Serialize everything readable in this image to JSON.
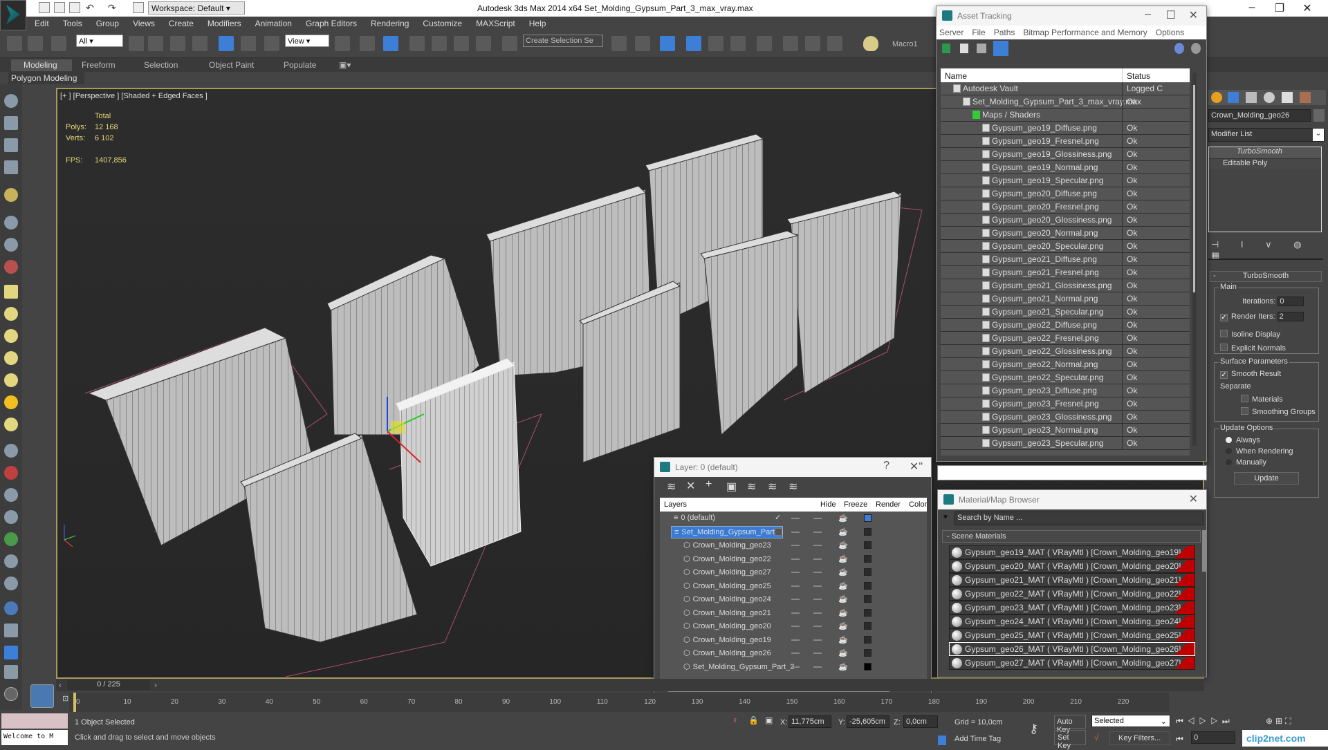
{
  "window": {
    "title": "Autodesk 3ds Max  2014 x64     Set_Molding_Gypsum_Part_3_max_vray.max",
    "workspace": "Workspace: Default"
  },
  "menu": [
    "Edit",
    "Tools",
    "Group",
    "Views",
    "Create",
    "Modifiers",
    "Animation",
    "Graph Editors",
    "Rendering",
    "Customize",
    "MAXScript",
    "Help"
  ],
  "toolbar": {
    "filter": "All",
    "refcoord": "View",
    "selection_set": "Create Selection Se",
    "macro": "Macro1"
  },
  "ribbon": {
    "tabs": [
      "Modeling",
      "Freeform",
      "Selection",
      "Object Paint",
      "Populate"
    ],
    "panel": "Polygon Modeling"
  },
  "viewport": {
    "label": "[+ ] [Perspective ] [Shaded + Edged Faces ]",
    "total_label": "Total",
    "polys_label": "Polys:",
    "polys": "12 168",
    "verts_label": "Verts:",
    "verts": "6 102",
    "fps_label": "FPS:",
    "fps": "1407,856"
  },
  "asset_tracking": {
    "title": "Asset Tracking",
    "menu": [
      "Server",
      "File",
      "Paths",
      "Bitmap Performance and Memory",
      "Options"
    ],
    "col_name": "Name",
    "col_status": "Status",
    "rows": [
      {
        "name": "Autodesk Vault",
        "status": "Logged C",
        "level": 1
      },
      {
        "name": "Set_Molding_Gypsum_Part_3_max_vray.max",
        "status": "Ok",
        "level": 2
      },
      {
        "name": "Maps / Shaders",
        "status": "",
        "level": 3
      },
      {
        "name": "Gypsum_geo19_Diffuse.png",
        "status": "Ok",
        "level": 4
      },
      {
        "name": "Gypsum_geo19_Fresnel.png",
        "status": "Ok",
        "level": 4
      },
      {
        "name": "Gypsum_geo19_Glossiness.png",
        "status": "Ok",
        "level": 4
      },
      {
        "name": "Gypsum_geo19_Normal.png",
        "status": "Ok",
        "level": 4
      },
      {
        "name": "Gypsum_geo19_Specular.png",
        "status": "Ok",
        "level": 4
      },
      {
        "name": "Gypsum_geo20_Diffuse.png",
        "status": "Ok",
        "level": 4
      },
      {
        "name": "Gypsum_geo20_Fresnel.png",
        "status": "Ok",
        "level": 4
      },
      {
        "name": "Gypsum_geo20_Glossiness.png",
        "status": "Ok",
        "level": 4
      },
      {
        "name": "Gypsum_geo20_Normal.png",
        "status": "Ok",
        "level": 4
      },
      {
        "name": "Gypsum_geo20_Specular.png",
        "status": "Ok",
        "level": 4
      },
      {
        "name": "Gypsum_geo21_Diffuse.png",
        "status": "Ok",
        "level": 4
      },
      {
        "name": "Gypsum_geo21_Fresnel.png",
        "status": "Ok",
        "level": 4
      },
      {
        "name": "Gypsum_geo21_Glossiness.png",
        "status": "Ok",
        "level": 4
      },
      {
        "name": "Gypsum_geo21_Normal.png",
        "status": "Ok",
        "level": 4
      },
      {
        "name": "Gypsum_geo21_Specular.png",
        "status": "Ok",
        "level": 4
      },
      {
        "name": "Gypsum_geo22_Diffuse.png",
        "status": "Ok",
        "level": 4
      },
      {
        "name": "Gypsum_geo22_Fresnel.png",
        "status": "Ok",
        "level": 4
      },
      {
        "name": "Gypsum_geo22_Glossiness.png",
        "status": "Ok",
        "level": 4
      },
      {
        "name": "Gypsum_geo22_Normal.png",
        "status": "Ok",
        "level": 4
      },
      {
        "name": "Gypsum_geo22_Specular.png",
        "status": "Ok",
        "level": 4
      },
      {
        "name": "Gypsum_geo23_Diffuse.png",
        "status": "Ok",
        "level": 4
      },
      {
        "name": "Gypsum_geo23_Fresnel.png",
        "status": "Ok",
        "level": 4
      },
      {
        "name": "Gypsum_geo23_Glossiness.png",
        "status": "Ok",
        "level": 4
      },
      {
        "name": "Gypsum_geo23_Normal.png",
        "status": "Ok",
        "level": 4
      },
      {
        "name": "Gypsum_geo23_Specular.png",
        "status": "Ok",
        "level": 4
      }
    ]
  },
  "command_panel": {
    "object_name": "Crown_Molding_geo26",
    "modifier_list": "Modifier List",
    "stack": [
      "TurboSmooth",
      "Editable Poly"
    ],
    "rollout": "TurboSmooth",
    "main": "Main",
    "iterations_label": "Iterations:",
    "iterations": "0",
    "render_iters_label": "Render Iters:",
    "render_iters": "2",
    "isoline": "Isoline Display",
    "explicit_normals": "Explicit Normals",
    "surface_params": "Surface Parameters",
    "smooth_result": "Smooth Result",
    "separate": "Separate",
    "materials": "Materials",
    "smoothing_groups": "Smoothing Groups",
    "update_options": "Update Options",
    "always": "Always",
    "when_rendering": "When Rendering",
    "manually": "Manually",
    "update": "Update"
  },
  "layers": {
    "title": "Layer: 0 (default)",
    "help": "?",
    "cols": [
      "Layers",
      "Hide",
      "Freeze",
      "Render",
      "Color"
    ],
    "rows": [
      {
        "name": "0 (default)",
        "level": 0,
        "color": "#3d7fd6"
      },
      {
        "name": "Set_Molding_Gypsum_Part_3",
        "level": 0,
        "selected": true,
        "color": "#2a2a2a"
      },
      {
        "name": "Crown_Molding_geo23",
        "level": 1,
        "color": "#2a2a2a"
      },
      {
        "name": "Crown_Molding_geo22",
        "level": 1,
        "color": "#2a2a2a"
      },
      {
        "name": "Crown_Molding_geo27",
        "level": 1,
        "color": "#2a2a2a"
      },
      {
        "name": "Crown_Molding_geo25",
        "level": 1,
        "color": "#2a2a2a"
      },
      {
        "name": "Crown_Molding_geo24",
        "level": 1,
        "color": "#2a2a2a"
      },
      {
        "name": "Crown_Molding_geo21",
        "level": 1,
        "color": "#2a2a2a"
      },
      {
        "name": "Crown_Molding_geo20",
        "level": 1,
        "color": "#2a2a2a"
      },
      {
        "name": "Crown_Molding_geo19",
        "level": 1,
        "color": "#2a2a2a"
      },
      {
        "name": "Crown_Molding_geo26",
        "level": 1,
        "color": "#2a2a2a"
      },
      {
        "name": "Set_Molding_Gypsum_Part_3",
        "level": 1,
        "color": "#000000"
      }
    ]
  },
  "material_browser": {
    "title": "Material/Map Browser",
    "search_placeholder": "Search by Name ...",
    "group": "- Scene Materials",
    "swatch_color": "#c00000",
    "items": [
      "Gypsum_geo19_MAT ( VRayMtl ) [Crown_Molding_geo19]",
      "Gypsum_geo20_MAT ( VRayMtl ) [Crown_Molding_geo20]",
      "Gypsum_geo21_MAT ( VRayMtl ) [Crown_Molding_geo21]",
      "Gypsum_geo22_MAT ( VRayMtl ) [Crown_Molding_geo22]",
      "Gypsum_geo23_MAT ( VRayMtl ) [Crown_Molding_geo23]",
      "Gypsum_geo24_MAT ( VRayMtl ) [Crown_Molding_geo24]",
      "Gypsum_geo25_MAT ( VRayMtl ) [Crown_Molding_geo25]",
      "Gypsum_geo26_MAT ( VRayMtl ) [Crown_Molding_geo26]",
      "Gypsum_geo27_MAT ( VRayMtl ) [Crown_Molding_geo27]"
    ],
    "selected_index": 7
  },
  "timeline": {
    "frame": "0 / 225",
    "ticks": [
      "0",
      "10",
      "20",
      "30",
      "40",
      "50",
      "60",
      "70",
      "80",
      "90",
      "100",
      "110",
      "120",
      "130",
      "140",
      "150",
      "160",
      "170",
      "180",
      "190",
      "200",
      "210",
      "220"
    ]
  },
  "status": {
    "welcome": "Welcome to M",
    "selected": "1 Object Selected",
    "prompt": "Click and drag to select and move objects",
    "x_label": "X:",
    "x": "11,775cm",
    "y_label": "Y:",
    "y": "-25,605cm",
    "z_label": "Z:",
    "z": "0,0cm",
    "grid": "Grid = 10,0cm",
    "add_time_tag": "Add Time Tag",
    "auto_key": "Auto Key",
    "set_key": "Set Key",
    "key_mode": "Selected",
    "key_filters": "Key Filters...",
    "frame": "0",
    "watermark": "clip2net.com"
  }
}
